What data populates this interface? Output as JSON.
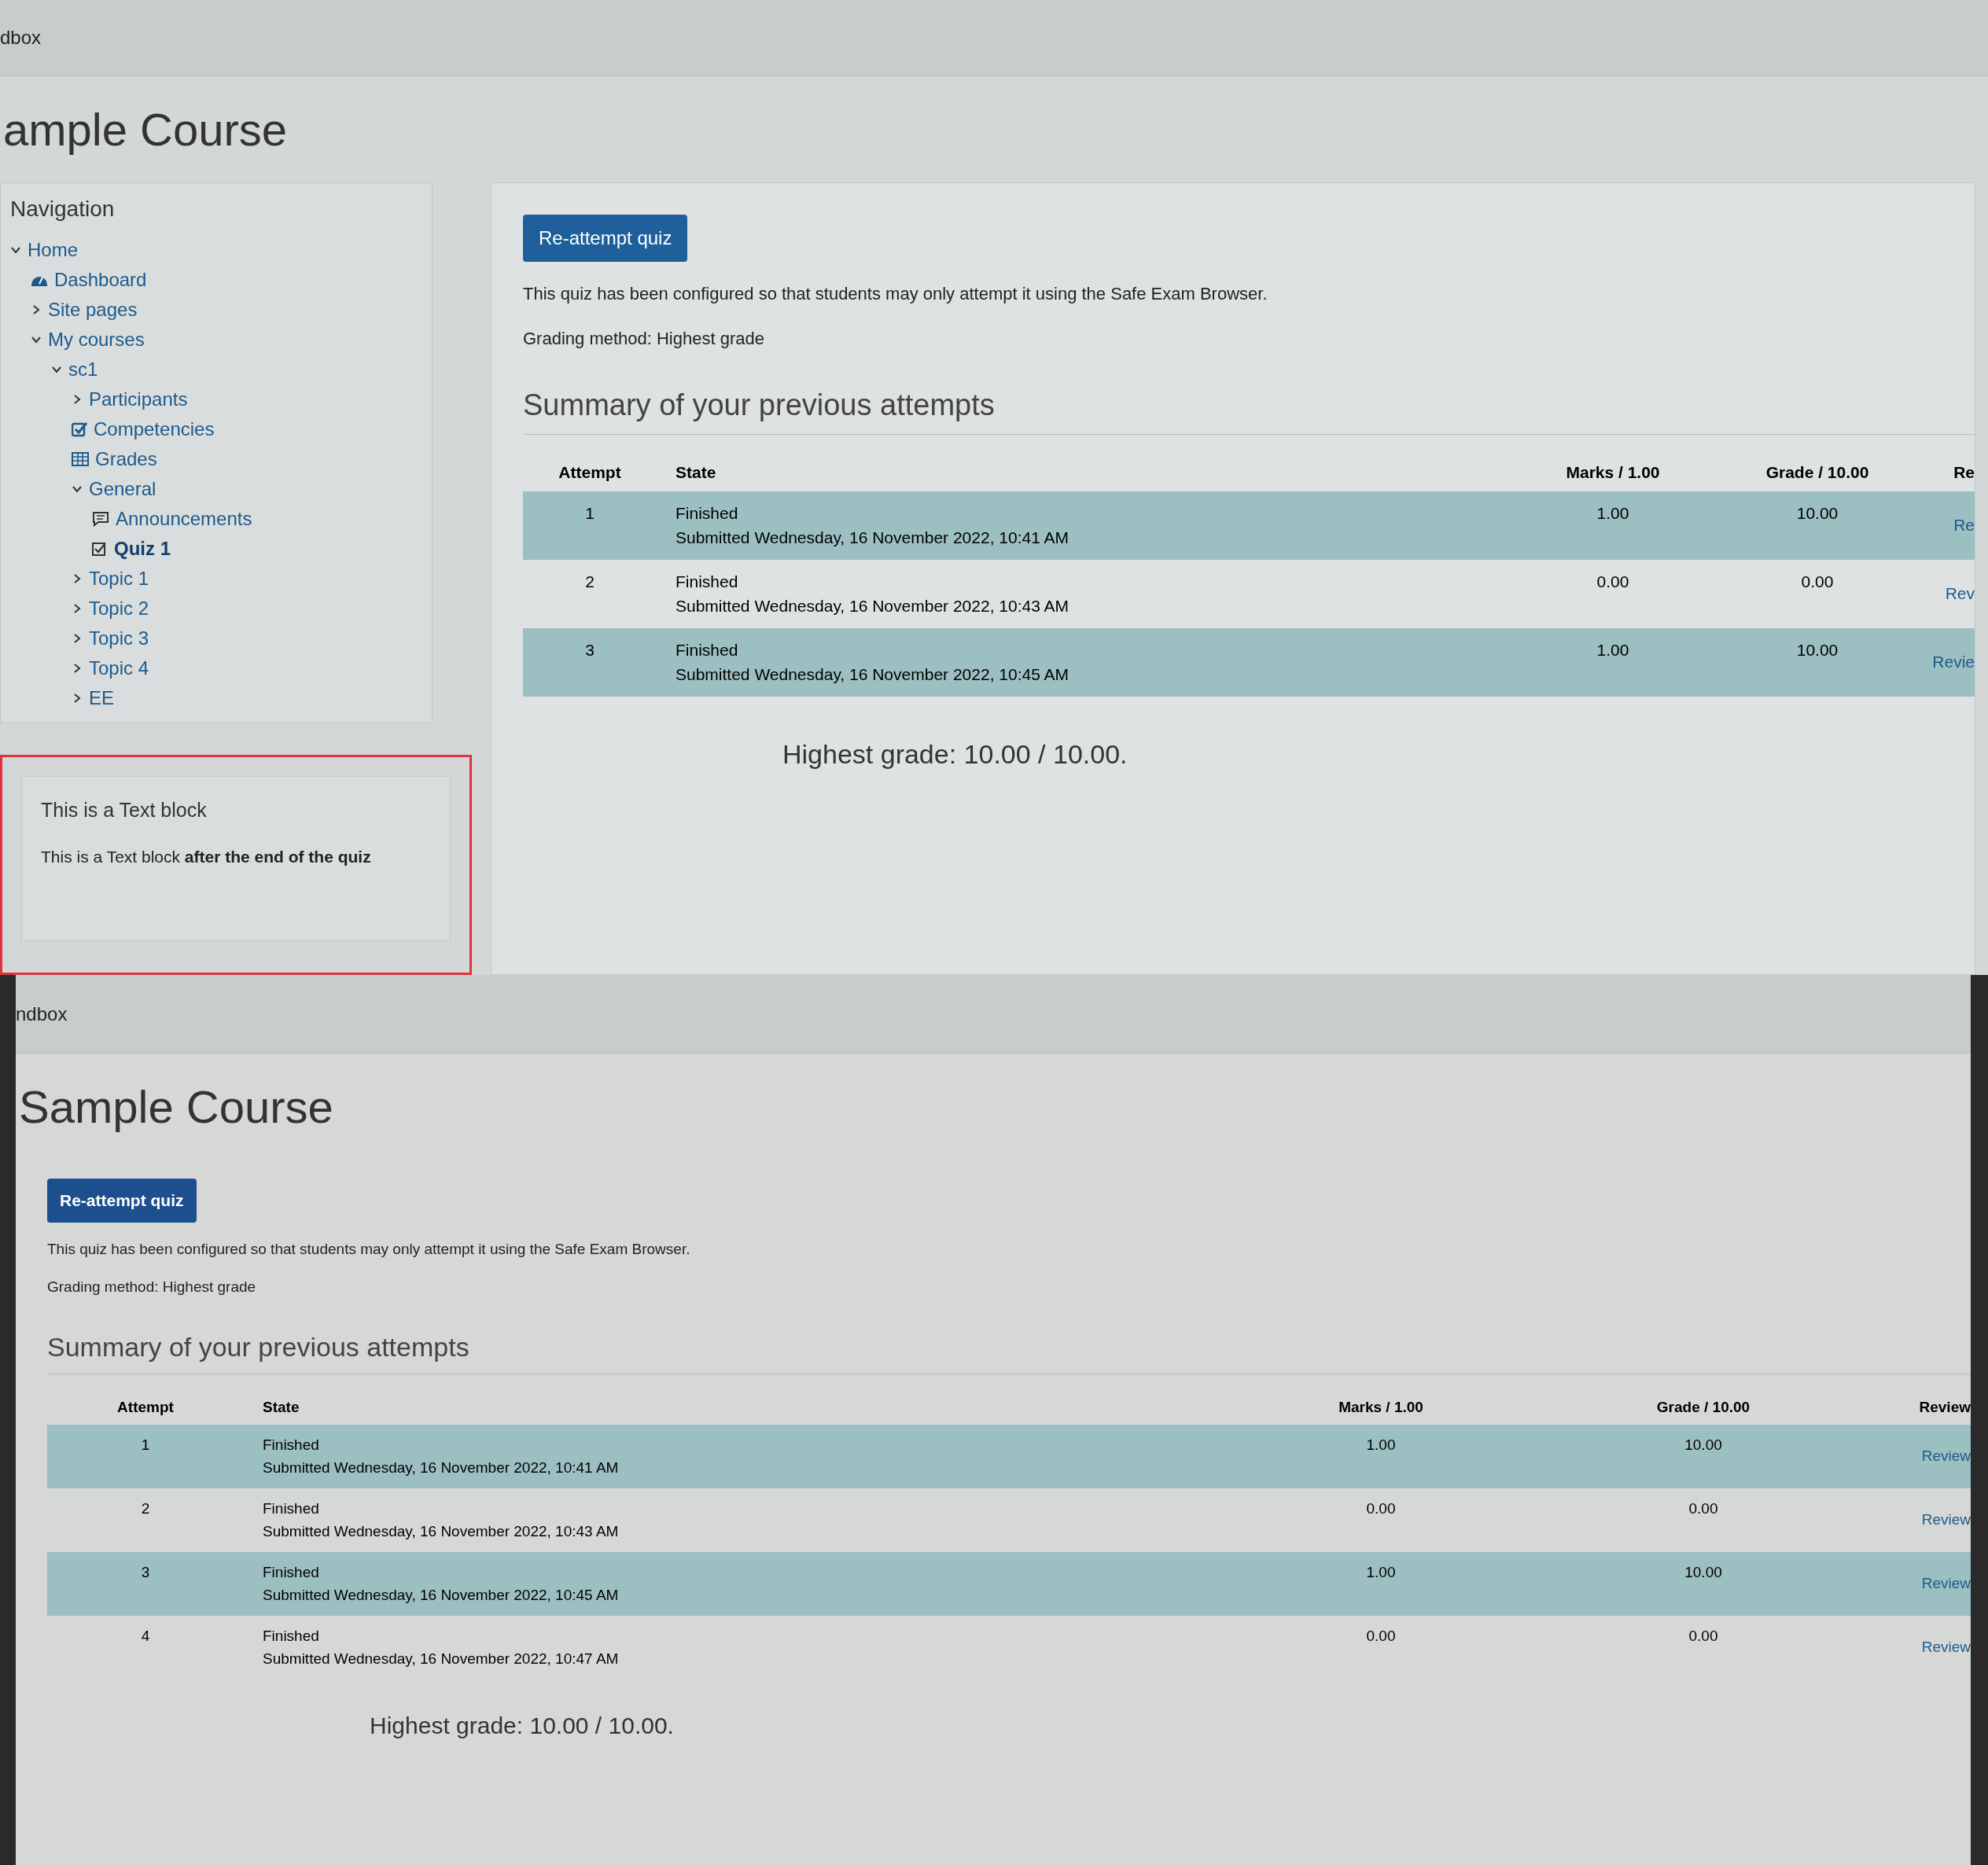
{
  "screens": [
    {
      "header": "dbox",
      "title": "ample Course",
      "navigation": {
        "title": "Navigation",
        "items": [
          {
            "label": "Home",
            "kind": "folder",
            "expanded": true,
            "selected": false,
            "children": [
              {
                "label": "Dashboard",
                "kind": "dashboard",
                "selected": false
              },
              {
                "label": "Site pages",
                "kind": "folder",
                "expanded": false,
                "selected": false
              },
              {
                "label": "My courses",
                "kind": "folder",
                "expanded": true,
                "selected": false,
                "children": [
                  {
                    "label": "sc1",
                    "kind": "folder",
                    "expanded": true,
                    "selected": false,
                    "children": [
                      {
                        "label": "Participants",
                        "kind": "folder",
                        "expanded": false,
                        "selected": false
                      },
                      {
                        "label": "Competencies",
                        "kind": "competency",
                        "selected": false
                      },
                      {
                        "label": "Grades",
                        "kind": "grades",
                        "selected": false
                      },
                      {
                        "label": "General",
                        "kind": "folder",
                        "expanded": true,
                        "selected": false,
                        "children": [
                          {
                            "label": "Announcements",
                            "kind": "forum",
                            "selected": false
                          },
                          {
                            "label": "Quiz 1",
                            "kind": "quiz",
                            "selected": true
                          }
                        ]
                      },
                      {
                        "label": "Topic 1",
                        "kind": "folder",
                        "expanded": false,
                        "selected": false
                      },
                      {
                        "label": "Topic 2",
                        "kind": "folder",
                        "expanded": false,
                        "selected": false
                      },
                      {
                        "label": "Topic 3",
                        "kind": "folder",
                        "expanded": false,
                        "selected": false
                      },
                      {
                        "label": "Topic 4",
                        "kind": "folder",
                        "expanded": false,
                        "selected": false
                      },
                      {
                        "label": "EE",
                        "kind": "folder",
                        "expanded": false,
                        "selected": false
                      }
                    ]
                  }
                ]
              }
            ]
          }
        ]
      },
      "text_block": {
        "title": "This is a Text block",
        "body": "This is a Text block **after the end of the quiz**"
      },
      "button": "Re-attempt quiz",
      "notice": "This quiz has been configured so that students may only attempt it using the Safe Exam Browser.",
      "grading_method": "Grading method: Highest grade",
      "summary_title": "Summary of your previous attempts",
      "columns": [
        "Attempt",
        "State",
        "Marks / 1.00",
        "Grade / 10.00",
        "Re"
      ],
      "rows": [
        {
          "attempt": "1",
          "state": "Finished",
          "submitted": "Submitted Wednesday, 16 November 2022, 10:41 AM",
          "marks": "1.00",
          "grade": "10.00",
          "review": "Re"
        },
        {
          "attempt": "2",
          "state": "Finished",
          "submitted": "Submitted Wednesday, 16 November 2022, 10:43 AM",
          "marks": "0.00",
          "grade": "0.00",
          "review": "Rev"
        },
        {
          "attempt": "3",
          "state": "Finished",
          "submitted": "Submitted Wednesday, 16 November 2022, 10:45 AM",
          "marks": "1.00",
          "grade": "10.00",
          "review": "Revie"
        }
      ],
      "highest_grade": "Highest grade: 10.00 / 10.00."
    },
    {
      "header": "ndbox",
      "title": "Sample Course",
      "button": "Re-attempt quiz",
      "notice": "This quiz has been configured so that students may only attempt it using the Safe Exam Browser.",
      "grading_method": "Grading method: Highest grade",
      "summary_title": "Summary of your previous attempts",
      "columns": [
        "Attempt",
        "State",
        "Marks / 1.00",
        "Grade / 10.00",
        "Review"
      ],
      "rows": [
        {
          "attempt": "1",
          "state": "Finished",
          "submitted": "Submitted Wednesday, 16 November 2022, 10:41 AM",
          "marks": "1.00",
          "grade": "10.00",
          "review": "Review"
        },
        {
          "attempt": "2",
          "state": "Finished",
          "submitted": "Submitted Wednesday, 16 November 2022, 10:43 AM",
          "marks": "0.00",
          "grade": "0.00",
          "review": "Review"
        },
        {
          "attempt": "3",
          "state": "Finished",
          "submitted": "Submitted Wednesday, 16 November 2022, 10:45 AM",
          "marks": "1.00",
          "grade": "10.00",
          "review": "Review"
        },
        {
          "attempt": "4",
          "state": "Finished",
          "submitted": "Submitted Wednesday, 16 November 2022, 10:47 AM",
          "marks": "0.00",
          "grade": "0.00",
          "review": "Review"
        }
      ],
      "highest_grade": "Highest grade: 10.00 / 10.00."
    }
  ]
}
